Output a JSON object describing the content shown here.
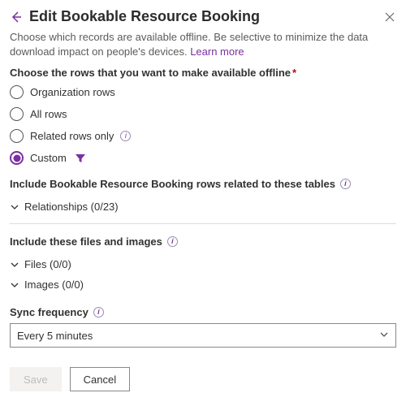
{
  "header": {
    "title": "Edit Bookable Resource Booking",
    "description": "Choose which records are available offline. Be selective to minimize the data download impact on people's devices.",
    "learn_more": "Learn more"
  },
  "rows_section": {
    "label": "Choose the rows that you want to make available offline",
    "options": {
      "organization": "Organization rows",
      "all": "All rows",
      "related": "Related rows only",
      "custom": "Custom"
    }
  },
  "related_tables": {
    "label": "Include Bookable Resource Booking rows related to these tables",
    "relationships": "Relationships (0/23)"
  },
  "files_images": {
    "label": "Include these files and images",
    "files": "Files (0/0)",
    "images": "Images (0/0)"
  },
  "sync": {
    "label": "Sync frequency",
    "value": "Every 5 minutes"
  },
  "buttons": {
    "save": "Save",
    "cancel": "Cancel"
  },
  "colors": {
    "accent": "#7b2fa0"
  }
}
